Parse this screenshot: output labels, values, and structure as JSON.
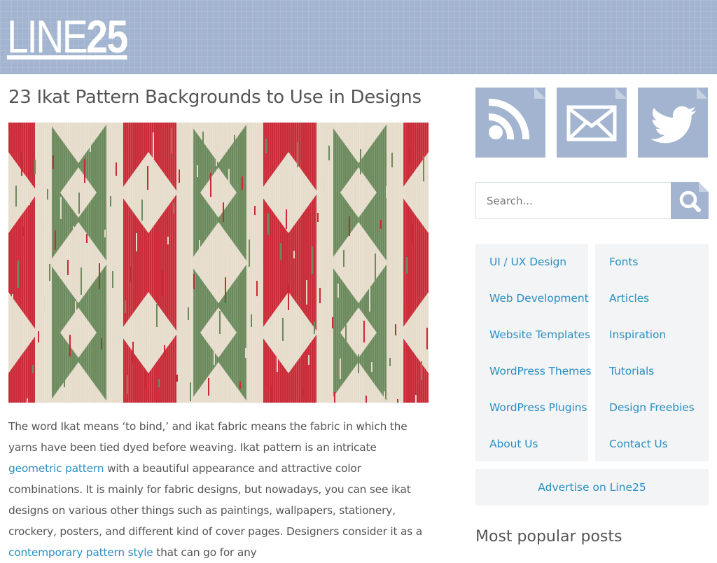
{
  "site": {
    "logo_light": "LINE",
    "logo_bold": "25"
  },
  "post": {
    "title": "23 Ikat Pattern Backgrounds to Use in Designs",
    "image_alt": "ikat pattern image",
    "body": {
      "p1_text1": "The word Ikat means ‘to bind,’ and ikat fabric means the fabric in which the yarns have been tied dyed before weaving. Ikat pattern is an intricate ",
      "p1_link1": "geometric pattern",
      "p1_text2": " with a beautiful appearance and attractive color combinations. It is mainly for fabric designs, but nowadays, you can see ikat designs on various other things such as paintings, wallpapers, stationery, crockery, posters, and different kind of cover pages. Designers consider it as a ",
      "p1_link2": "contemporary pattern style",
      "p1_text3": " that can go for any"
    }
  },
  "sidebar": {
    "social": [
      {
        "name": "rss",
        "icon": "rss-icon"
      },
      {
        "name": "email",
        "icon": "envelope-icon"
      },
      {
        "name": "twitter",
        "icon": "twitter-icon"
      }
    ],
    "search": {
      "placeholder": "Search...",
      "icon": "search-icon"
    },
    "categories_left": [
      "UI / UX Design",
      "Web Development",
      "Website Templates",
      "WordPress Themes",
      "WordPress Plugins",
      "About Us"
    ],
    "categories_right": [
      "Fonts",
      "Articles",
      "Inspiration",
      "Tutorials",
      "Design Freebies",
      "Contact Us"
    ],
    "advertise_label": "Advertise on Line25",
    "popular_heading": "Most popular posts"
  },
  "colors": {
    "header_bg": "#a2b4cf",
    "link": "#2a8fc1",
    "text": "#555555",
    "sidebar_box": "#f3f4f6",
    "ikat_red": "#c92a36",
    "ikat_green": "#6b8a5c",
    "ikat_cream": "#e6dccb"
  }
}
